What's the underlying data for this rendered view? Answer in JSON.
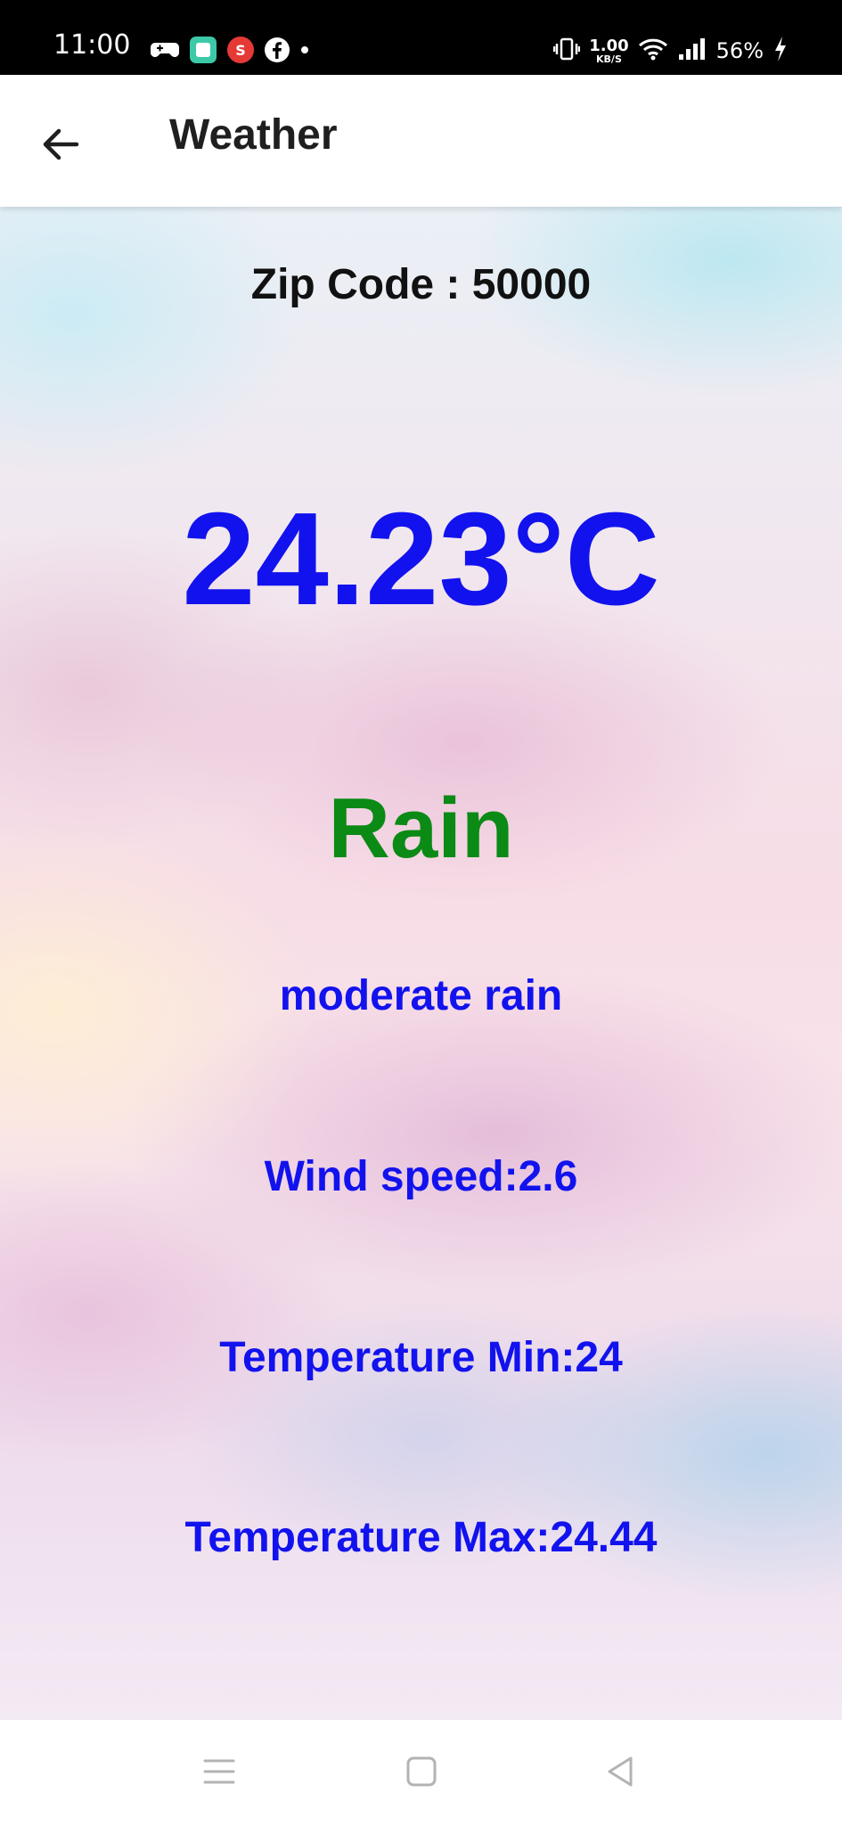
{
  "status_bar": {
    "time": "11:00",
    "net_speed_value": "1.00",
    "net_speed_unit": "KB/S",
    "battery_percent": "56%",
    "notification_icons": [
      "game-controller-icon",
      "app-square-icon",
      "s-badge-icon",
      "facebook-icon",
      "dot-icon"
    ],
    "system_icons": [
      "vibrate-icon",
      "wifi-icon",
      "signal-icon",
      "battery-charging-icon"
    ]
  },
  "app_bar": {
    "title": "Weather",
    "back_icon": "arrow-left-icon"
  },
  "weather": {
    "zip_label": "Zip Code : 50000",
    "temperature": "24.23°C",
    "main": "Rain",
    "description": "moderate rain",
    "wind_speed": "Wind speed:2.6",
    "temp_min": "Temperature Min:24",
    "temp_max": "Temperature Max:24.44"
  },
  "colors": {
    "primary_text": "#1212ee",
    "condition_text": "#0b8a16",
    "zip_text": "#111111",
    "status_bar_bg": "#000000"
  },
  "nav_bar": {
    "icons": [
      "recents-icon",
      "home-icon",
      "back-triangle-icon"
    ]
  }
}
